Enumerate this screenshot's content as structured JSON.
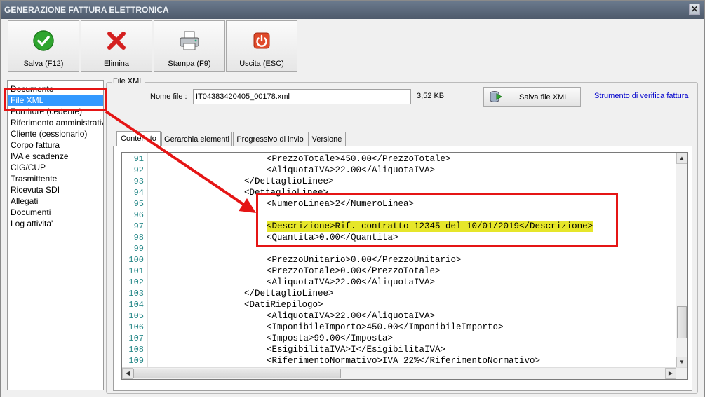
{
  "window": {
    "title": "GENERAZIONE FATTURA ELETTRONICA",
    "close_glyph": "✕"
  },
  "toolbar": [
    {
      "label": "Salva (F12)",
      "icon": "check-icon"
    },
    {
      "label": "Elimina",
      "icon": "delete-x-icon"
    },
    {
      "label": "Stampa (F9)",
      "icon": "printer-icon"
    },
    {
      "label": "Uscita (ESC)",
      "icon": "exit-power-icon"
    }
  ],
  "sidebar": {
    "items": [
      "Documento",
      "File XML",
      "Fornitore (cedente)",
      "Riferimento amministrativo",
      "Cliente (cessionario)",
      "Corpo fattura",
      "IVA e scadenze",
      "CIG/CUP",
      "Trasmittente",
      "Ricevuta SDI",
      "Allegati",
      "Documenti",
      "Log attivita'"
    ],
    "selected": "File XML"
  },
  "file_group": {
    "title": "File XML",
    "name_label": "Nome file :",
    "name_value": "IT04383420405_00178.xml",
    "size": "3,52 KB",
    "save_button": "Salva file XML",
    "verify_link": "Strumento di verifica fattura"
  },
  "tabs": [
    "Contenuto",
    "Gerarchia elementi",
    "Progressivo di invio",
    "Versione"
  ],
  "active_tab": "Contenuto",
  "code": {
    "line_numbers": [
      "91",
      "92",
      "93",
      "94",
      "95",
      "96",
      "97",
      "98",
      "99",
      "100",
      "101",
      "102",
      "103",
      "104",
      "105",
      "106",
      "107",
      "108",
      "109"
    ],
    "lines": [
      "<PrezzoTotale>450.00</PrezzoTotale>",
      "<AliquotaIVA>22.00</AliquotaIVA>",
      "</DettaglioLinee>",
      "<DettaglioLinee>",
      "<NumeroLinea>2</NumeroLinea>",
      "",
      "<Descrizione>Rif. contratto 12345 del 10/01/2019</Descrizione>",
      "<Quantita>0.00</Quantita>",
      "",
      "<PrezzoUnitario>0.00</PrezzoUnitario>",
      "<PrezzoTotale>0.00</PrezzoTotale>",
      "<AliquotaIVA>22.00</AliquotaIVA>",
      "</DettaglioLinee>",
      "<DatiRiepilogo>",
      "<AliquotaIVA>22.00</AliquotaIVA>",
      "<ImponibileImporto>450.00</ImponibileImporto>",
      "<Imposta>99.00</Imposta>",
      "<EsigibilitaIVA>I</EsigibilitaIVA>",
      "<RiferimentoNormativo>IVA 22%</RiferimentoNormativo>"
    ],
    "highlighted_line": "97"
  },
  "colors": {
    "highlight": "#e6e62a",
    "annotation": "#e51515",
    "selection": "#3399ff",
    "line_numbers": "#2a8a8a",
    "link": "#0000cc"
  }
}
